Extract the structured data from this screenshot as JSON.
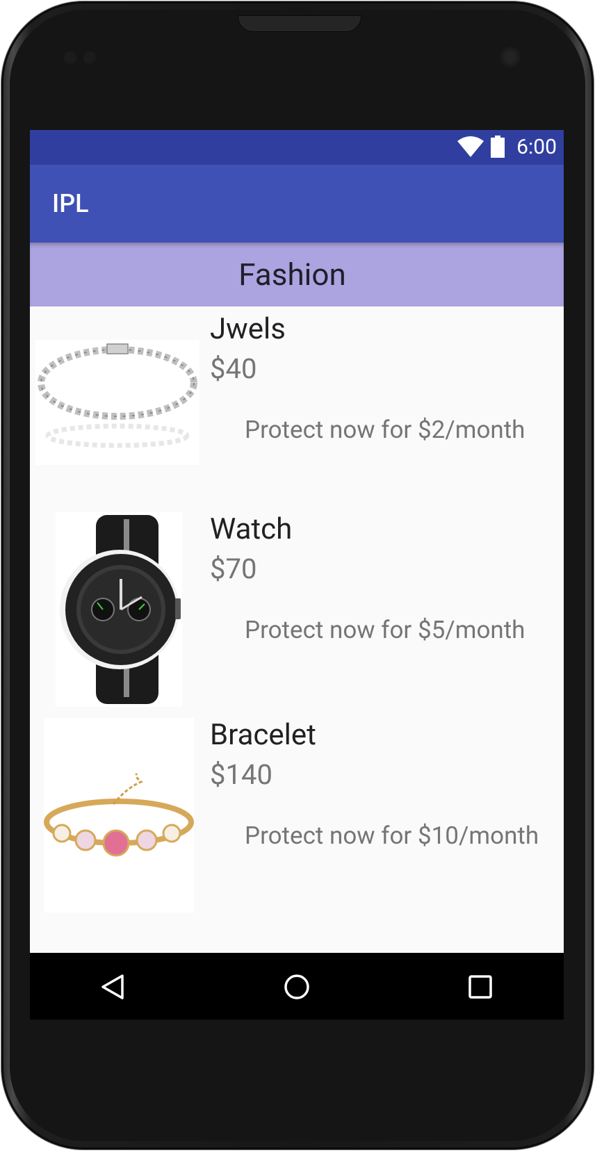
{
  "status_bar": {
    "time": "6:00",
    "icons": [
      "wifi-icon",
      "battery-icon"
    ]
  },
  "app_bar": {
    "title": "IPL"
  },
  "category": {
    "title": "Fashion"
  },
  "products": [
    {
      "name": "Jwels",
      "price": "$40",
      "protect_label": "Protect now for $2/month",
      "image": "silver-bracelet"
    },
    {
      "name": "Watch",
      "price": "$70",
      "protect_label": "Protect now for $5/month",
      "image": "wrist-watch"
    },
    {
      "name": "Bracelet",
      "price": "$140",
      "protect_label": "Protect now for $10/month",
      "image": "gold-heart-bracelet"
    }
  ],
  "navigation": {
    "buttons": [
      "back-icon",
      "home-icon",
      "recents-icon"
    ]
  },
  "colors": {
    "status_bar": "#303f9f",
    "app_bar": "#3f51b5",
    "category_bar": "#aba4e0",
    "background": "#fafafa"
  }
}
